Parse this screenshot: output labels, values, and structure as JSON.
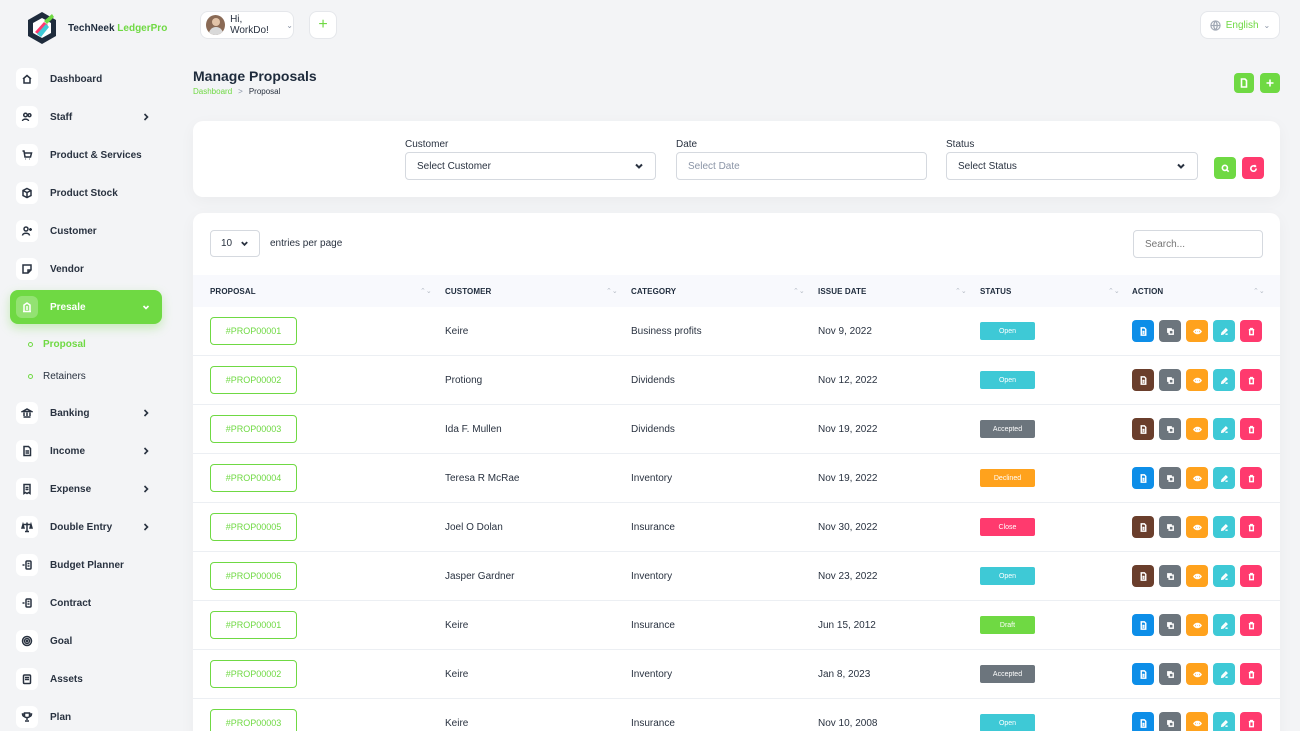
{
  "brand": {
    "name_prefix": "TechNeek ",
    "name_accent": "LedgerPro"
  },
  "header": {
    "greeting": "Hi, WorkDo!",
    "language": "English"
  },
  "sidebar": {
    "items": [
      {
        "label": "Dashboard",
        "icon": "home-icon",
        "has_arrow": false
      },
      {
        "label": "Staff",
        "icon": "users-icon",
        "has_arrow": true
      },
      {
        "label": "Product & Services",
        "icon": "cart-icon",
        "has_arrow": false
      },
      {
        "label": "Product Stock",
        "icon": "box-icon",
        "has_arrow": false
      },
      {
        "label": "Customer",
        "icon": "user-plus-icon",
        "has_arrow": false
      },
      {
        "label": "Vendor",
        "icon": "note-icon",
        "has_arrow": false
      },
      {
        "label": "Presale",
        "icon": "building-icon",
        "has_arrow": true,
        "active": true
      }
    ],
    "subitems": [
      {
        "label": "Proposal",
        "active": true
      },
      {
        "label": "Retainers",
        "active": false
      }
    ],
    "items2": [
      {
        "label": "Banking",
        "icon": "bank-icon",
        "has_arrow": true
      },
      {
        "label": "Income",
        "icon": "file-icon",
        "has_arrow": true
      },
      {
        "label": "Expense",
        "icon": "receipt-icon",
        "has_arrow": true
      },
      {
        "label": "Double Entry",
        "icon": "balance-icon",
        "has_arrow": true
      },
      {
        "label": "Budget Planner",
        "icon": "coins-icon",
        "has_arrow": false
      },
      {
        "label": "Contract",
        "icon": "coins-icon",
        "has_arrow": false
      },
      {
        "label": "Goal",
        "icon": "target-icon",
        "has_arrow": false
      },
      {
        "label": "Assets",
        "icon": "calendar-icon",
        "has_arrow": false
      },
      {
        "label": "Plan",
        "icon": "trophy-icon",
        "has_arrow": false
      }
    ]
  },
  "page": {
    "title": "Manage Proposals",
    "breadcrumb_home": "Dashboard",
    "breadcrumb_sep": ">",
    "breadcrumb_current": "Proposal"
  },
  "filters": {
    "customer_label": "Customer",
    "customer_value": "Select Customer",
    "date_label": "Date",
    "date_placeholder": "Select Date",
    "status_label": "Status",
    "status_value": "Select Status"
  },
  "table": {
    "entries_value": "10",
    "entries_text": "entries per page",
    "search_placeholder": "Search...",
    "columns": [
      "PROPOSAL",
      "CUSTOMER",
      "CATEGORY",
      "ISSUE DATE",
      "STATUS",
      "ACTION"
    ],
    "rows": [
      {
        "id": "#PROP00001",
        "customer": "Keire",
        "category": "Business profits",
        "date": "Nov 9, 2022",
        "status": "Open",
        "status_color": "#3ec9d6",
        "first_action_color": "#0d8ee8"
      },
      {
        "id": "#PROP00002",
        "customer": "Protiong",
        "category": "Dividends",
        "date": "Nov 12, 2022",
        "status": "Open",
        "status_color": "#3ec9d6",
        "first_action_color": "#6a3e2c"
      },
      {
        "id": "#PROP00003",
        "customer": "Ida F. Mullen",
        "category": "Dividends",
        "date": "Nov 19, 2022",
        "status": "Accepted",
        "status_color": "#6c757d",
        "first_action_color": "#6a3e2c"
      },
      {
        "id": "#PROP00004",
        "customer": "Teresa R McRae",
        "category": "Inventory",
        "date": "Nov 19, 2022",
        "status": "Declined",
        "status_color": "#ffa21d",
        "first_action_color": "#0d8ee8"
      },
      {
        "id": "#PROP00005",
        "customer": "Joel O Dolan",
        "category": "Insurance",
        "date": "Nov 30, 2022",
        "status": "Close",
        "status_color": "#ff3a6e",
        "first_action_color": "#6a3e2c"
      },
      {
        "id": "#PROP00006",
        "customer": "Jasper Gardner",
        "category": "Inventory",
        "date": "Nov 23, 2022",
        "status": "Open",
        "status_color": "#3ec9d6",
        "first_action_color": "#6a3e2c"
      },
      {
        "id": "#PROP00001",
        "customer": "Keire",
        "category": "Insurance",
        "date": "Jun 15, 2012",
        "status": "Draft",
        "status_color": "#6fd943",
        "first_action_color": "#0d8ee8"
      },
      {
        "id": "#PROP00002",
        "customer": "Keire",
        "category": "Inventory",
        "date": "Jan 8, 2023",
        "status": "Accepted",
        "status_color": "#6c757d",
        "first_action_color": "#0d8ee8"
      },
      {
        "id": "#PROP00003",
        "customer": "Keire",
        "category": "Insurance",
        "date": "Nov 10, 2008",
        "status": "Open",
        "status_color": "#3ec9d6",
        "first_action_color": "#0d8ee8"
      }
    ]
  },
  "colors": {
    "accent": "#6fd943",
    "danger": "#ff3a6e",
    "gray": "#6c757d",
    "warning": "#ffa21d",
    "info": "#3ec9d6"
  }
}
